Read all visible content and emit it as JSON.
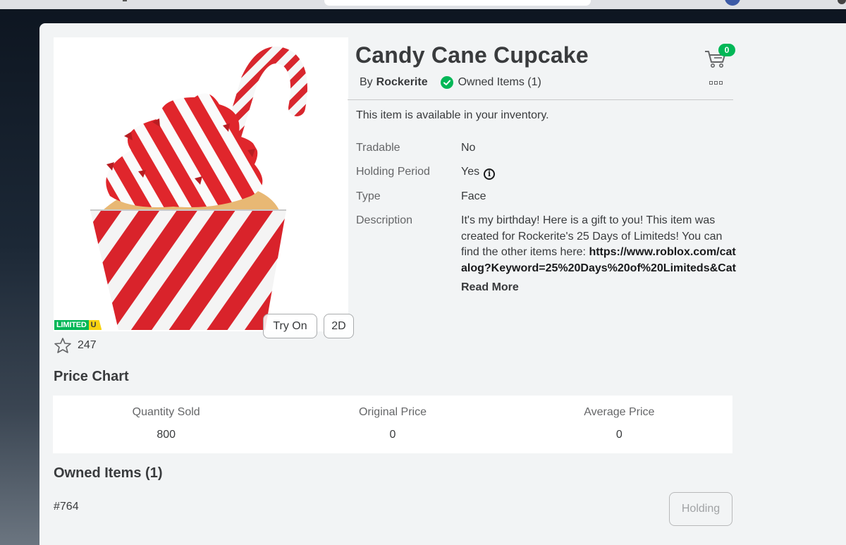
{
  "item": {
    "title": "Candy Cane Cupcake",
    "by_label": "By",
    "creator": "Rockerite",
    "owned_label": "Owned Items (1)",
    "availability": "This item is available in your inventory.",
    "badge_limited": "LIMITED",
    "badge_u": "U",
    "favorites": "247"
  },
  "thumbnail_buttons": {
    "try_on": "Try On",
    "two_d": "2D"
  },
  "cart": {
    "count": "0"
  },
  "details": {
    "tradable_label": "Tradable",
    "tradable_value": "No",
    "holding_label": "Holding Period",
    "holding_value": "Yes",
    "type_label": "Type",
    "type_value": "Face",
    "description_label": "Description",
    "description_text": "It's my birthday! Here is a gift to you! This item was created for Rockerite's 25 Days of Limiteds! You can find the other items here: ",
    "description_link": "https://www.roblox.com/catalog?Keyword=25%20Days%20of%20Limiteds&Cat",
    "read_more": "Read More",
    "info_icon_glyph": "i"
  },
  "price_chart": {
    "title": "Price Chart",
    "columns": [
      {
        "label": "Quantity Sold",
        "value": "800"
      },
      {
        "label": "Original Price",
        "value": "0"
      },
      {
        "label": "Average Price",
        "value": "0"
      }
    ]
  },
  "owned_items": {
    "title": "Owned Items (1)",
    "rows": [
      {
        "id": "#764",
        "action": "Holding"
      }
    ]
  },
  "colors": {
    "accent_green": "#02b757",
    "limited_yellow": "#f8d210",
    "card_bg": "#f2f4f5",
    "text_primary": "#393b3d"
  },
  "icons": [
    "cart-icon",
    "more-icon",
    "verified-check-icon",
    "info-icon",
    "star-icon"
  ]
}
